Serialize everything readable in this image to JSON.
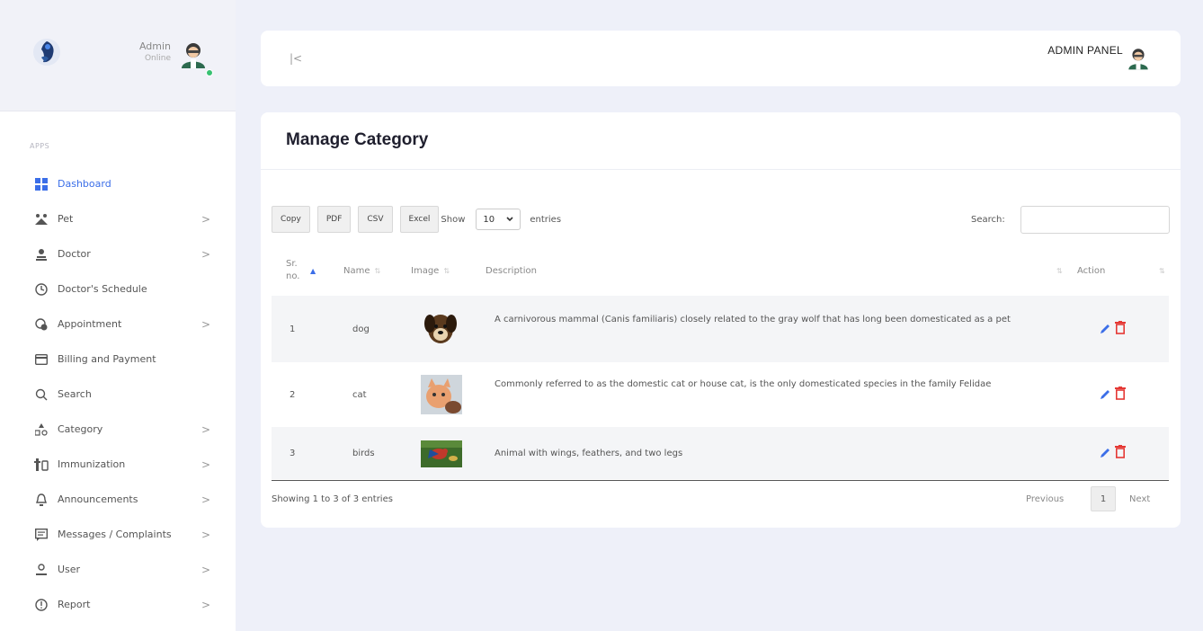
{
  "sidebar": {
    "admin_name": "Admin",
    "admin_status": "Online",
    "apps_label": "APPS",
    "items": [
      {
        "label": "Dashboard",
        "icon": "dashboard-icon",
        "arrow": ""
      },
      {
        "label": "Pet",
        "icon": "pet-icon",
        "arrow": ">"
      },
      {
        "label": "Doctor",
        "icon": "doctor-icon",
        "arrow": ">"
      },
      {
        "label": "Doctor's Schedule",
        "icon": "clock-icon",
        "arrow": ""
      },
      {
        "label": "Appointment",
        "icon": "appointment-icon",
        "arrow": ">"
      },
      {
        "label": "Billing and Payment",
        "icon": "credit-card-icon",
        "arrow": ""
      },
      {
        "label": "Search",
        "icon": "search-icon",
        "arrow": ""
      },
      {
        "label": "Category",
        "icon": "category-icon",
        "arrow": ">"
      },
      {
        "label": "Immunization",
        "icon": "immunization-icon",
        "arrow": ">"
      },
      {
        "label": "Announcements",
        "icon": "bell-icon",
        "arrow": ">"
      },
      {
        "label": "Messages / Complaints",
        "icon": "message-icon",
        "arrow": ">"
      },
      {
        "label": "User",
        "icon": "user-icon",
        "arrow": ">"
      },
      {
        "label": "Report",
        "icon": "report-icon",
        "arrow": ">"
      }
    ]
  },
  "header": {
    "collapse_label": "|<",
    "panel_title": "ADMIN PANEL"
  },
  "main": {
    "title": "Manage Category",
    "buttons": {
      "copy": "Copy",
      "pdf": "PDF",
      "csv": "CSV",
      "excel": "Excel"
    },
    "show_label": "Show",
    "entries_value": "10",
    "entries_label": "entries",
    "search_label": "Search:",
    "search_value": "",
    "columns": {
      "sr": "Sr. no.",
      "name": "Name",
      "image": "Image",
      "description": "Description",
      "action": "Action"
    },
    "rows": [
      {
        "sr": "1",
        "name": "dog",
        "description": "A carnivorous mammal (Canis familiaris) closely related to the gray wolf that has long been domesticated as a pet"
      },
      {
        "sr": "2",
        "name": "cat",
        "description": "Commonly referred to as the domestic cat or house cat, is the only domesticated species in the family Felidae"
      },
      {
        "sr": "3",
        "name": "birds",
        "description": "Animal with wings, feathers, and two legs"
      }
    ],
    "showing": "Showing 1 to 3 of 3 entries",
    "pagination": {
      "previous": "Previous",
      "current": "1",
      "next": "Next"
    }
  },
  "colors": {
    "accent": "#3b6ee8",
    "delete": "#e53935",
    "online": "#38c172",
    "background": "#eef0f9"
  }
}
